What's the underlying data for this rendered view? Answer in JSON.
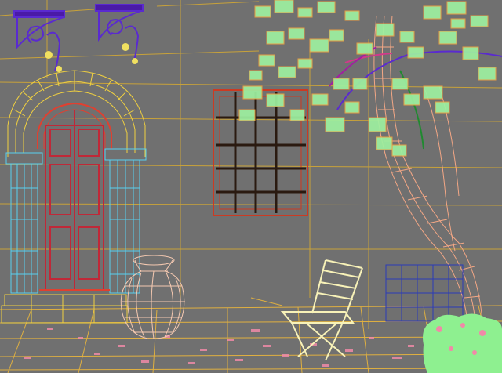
{
  "viewport": {
    "background": "#707070"
  },
  "colors": {
    "grid": "#e8c64a",
    "floor": "#e0b040",
    "wall_line": "#c8a23a",
    "arch_outer": "#f0d040",
    "arch_inner": "#e04030",
    "door": "#c02838",
    "pillar": "#58d0f0",
    "window": "#cc3a22",
    "window_bars": "#2a1a10",
    "bracket": "#5a2ad0",
    "tree_trunk": "#f3a785",
    "leaves": "#9ef0a0",
    "leaf_orange": "#f0a040",
    "vase": "#f4c8b0",
    "chair": "#f8f2b8",
    "lattice": "#2a3ab8",
    "bush": "#8ef090",
    "petals": "#f08aa8"
  },
  "objects": [
    {
      "name": "wall-bracket-left",
      "icon": "ornamental-bracket"
    },
    {
      "name": "wall-bracket-right",
      "icon": "ornamental-bracket"
    },
    {
      "name": "arched-doorway",
      "icon": "door-arch"
    },
    {
      "name": "barred-window",
      "icon": "window-grid"
    },
    {
      "name": "tree",
      "icon": "tree"
    },
    {
      "name": "clay-vase",
      "icon": "vase"
    },
    {
      "name": "folding-chair",
      "icon": "chair"
    },
    {
      "name": "trellis-panel",
      "icon": "lattice"
    },
    {
      "name": "flower-bush",
      "icon": "bush"
    }
  ]
}
